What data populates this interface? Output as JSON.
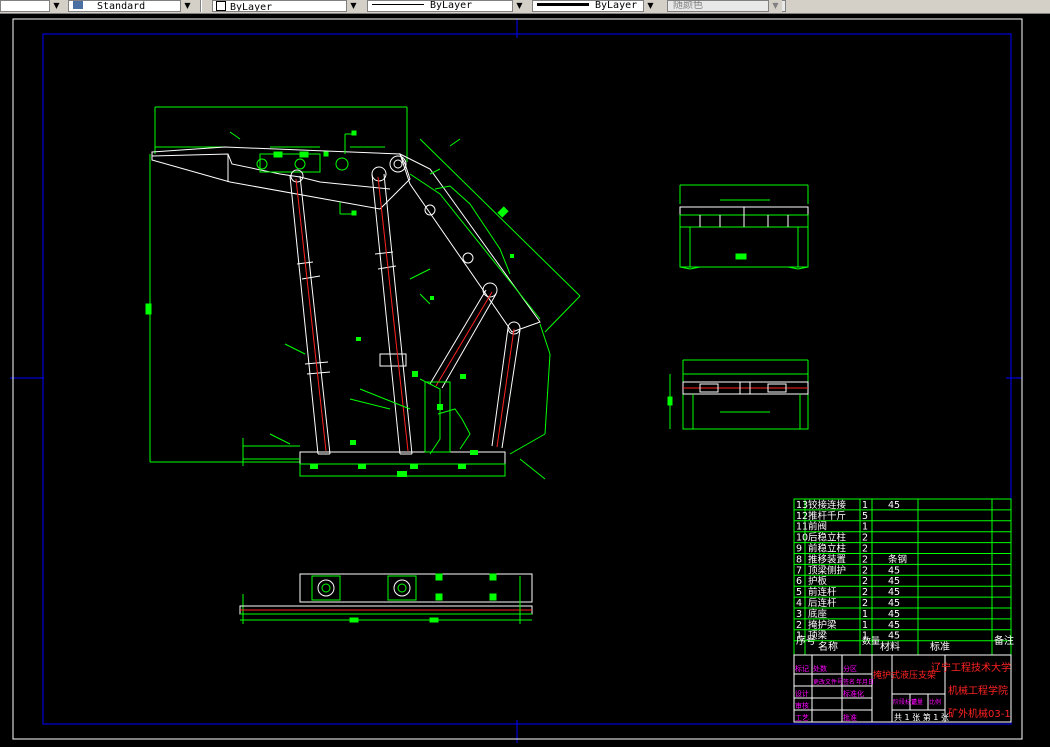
{
  "toolbar": {
    "text_style": "Standard",
    "layer_combo": "ByLayer",
    "linetype_combo": "ByLayer",
    "lineweight_combo": "ByLayer",
    "color_combo": "随颜色"
  },
  "bom": {
    "rows": [
      {
        "no": "13",
        "name": "铰接连接",
        "qty": "1",
        "material": "45"
      },
      {
        "no": "12",
        "name": "推杆千斤",
        "qty": "5",
        "material": ""
      },
      {
        "no": "11",
        "name": "前阀",
        "qty": "1",
        "material": ""
      },
      {
        "no": "10",
        "name": "后稳立柱",
        "qty": "2",
        "material": ""
      },
      {
        "no": "9",
        "name": "前稳立柱",
        "qty": "2",
        "material": ""
      },
      {
        "no": "8",
        "name": "推移装置",
        "qty": "2",
        "material": "条钢"
      },
      {
        "no": "7",
        "name": "顶梁侧护",
        "qty": "2",
        "material": "45"
      },
      {
        "no": "6",
        "name": "护板",
        "qty": "2",
        "material": "45"
      },
      {
        "no": "5",
        "name": "前连杆",
        "qty": "2",
        "material": "45"
      },
      {
        "no": "4",
        "name": "后连杆",
        "qty": "2",
        "material": "45"
      },
      {
        "no": "3",
        "name": "底座",
        "qty": "1",
        "material": "45"
      },
      {
        "no": "2",
        "name": "掩护梁",
        "qty": "1",
        "material": "45"
      },
      {
        "no": "1",
        "name": "顶梁",
        "qty": "1",
        "material": "45"
      }
    ],
    "header": {
      "no": "序号",
      "name": "名称",
      "qty": "数量",
      "material": "材料",
      "standard": "标准",
      "remark": "备注"
    }
  },
  "title_block": {
    "university": "辽宁工程技术大学",
    "drawing_title": "掩护式液压支架",
    "college": "机械工程学院",
    "class_no": "矿外机械03-1",
    "stage_label": "阶段标记",
    "weight_label": "重量",
    "scale_label": "比例",
    "sheet_label": "共 1 张 第 1 张",
    "mark_col": "标记",
    "count_col": "处数",
    "zone_col": "分区",
    "doc_col": "更改文件号",
    "sign_col": "签名",
    "date_col": "年月日",
    "designer": "设计",
    "standardize": "标准化",
    "review": "审核",
    "process": "工艺",
    "approve": "批准"
  }
}
